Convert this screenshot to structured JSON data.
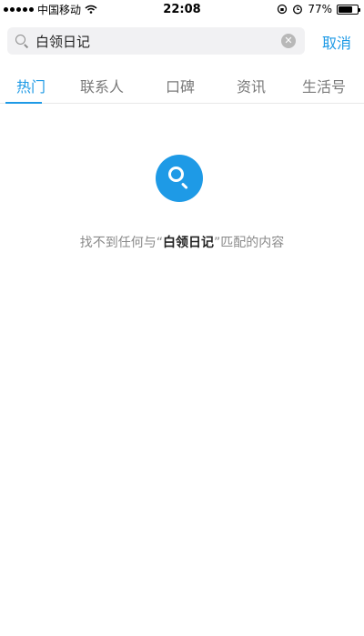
{
  "status_bar": {
    "carrier": "中国移动",
    "time": "22:08",
    "battery_percent": "77%",
    "battery_level": 0.77
  },
  "search": {
    "value": "白领日记",
    "cancel_label": "取消"
  },
  "tabs": [
    {
      "label": "热门",
      "active": true
    },
    {
      "label": "联系人",
      "active": false
    },
    {
      "label": "口碑",
      "active": false
    },
    {
      "label": "资讯",
      "active": false
    },
    {
      "label": "生活号",
      "active": false
    }
  ],
  "empty_state": {
    "prefix": "找不到任何与“",
    "keyword": "白领日记",
    "suffix": "”匹配的内容"
  },
  "colors": {
    "accent": "#1e9ae6"
  }
}
